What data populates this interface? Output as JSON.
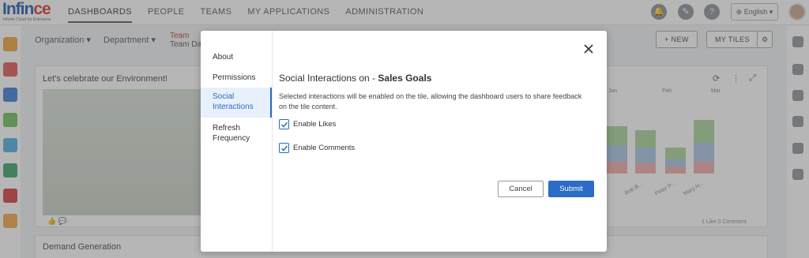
{
  "logo": {
    "brand_a": "Inf",
    "brand_b": "in",
    "brand_c": "ce",
    "tagline": "Infinite Cloud for Enterprise"
  },
  "nav": {
    "items": [
      "DASHBOARDS",
      "PEOPLE",
      "TEAMS",
      "MY APPLICATIONS",
      "ADMINISTRATION"
    ]
  },
  "header": {
    "language": "English"
  },
  "subbar": {
    "organization": "Organization",
    "department": "Department",
    "team_label": "Team",
    "team_value": "Team Da",
    "new_button": "+ NEW",
    "my_tiles_button": "MY TILES"
  },
  "tiles": {
    "environment_title": "Let's celebrate our Environment!",
    "demand_title": "Demand Generation",
    "chart_legend": [
      "Jan",
      "Feb",
      "Mar"
    ],
    "chart_x_labels": [
      "Bob B...",
      "Peter P...",
      "Mary H..."
    ],
    "chart_footer": "1 Like  0 Comment"
  },
  "modal": {
    "nav": [
      "About",
      "Permissions",
      "Social\nInteractions",
      "Refresh\nFrequency"
    ],
    "title_prefix": "Social Interactions on - ",
    "title_bold": "Sales Goals",
    "description": "Selected interactions will be enabled on the tile, allowing the dashboard users to share feedback on the tile content.",
    "checkboxes": [
      {
        "label": "Enable Likes",
        "checked": true
      },
      {
        "label": "Enable Comments",
        "checked": true
      }
    ],
    "cancel_label": "Cancel",
    "submit_label": "Submit"
  },
  "colors": {
    "accent": "#2b6cc4",
    "brand_blue": "#1f57a8",
    "brand_red": "#d9352b"
  }
}
